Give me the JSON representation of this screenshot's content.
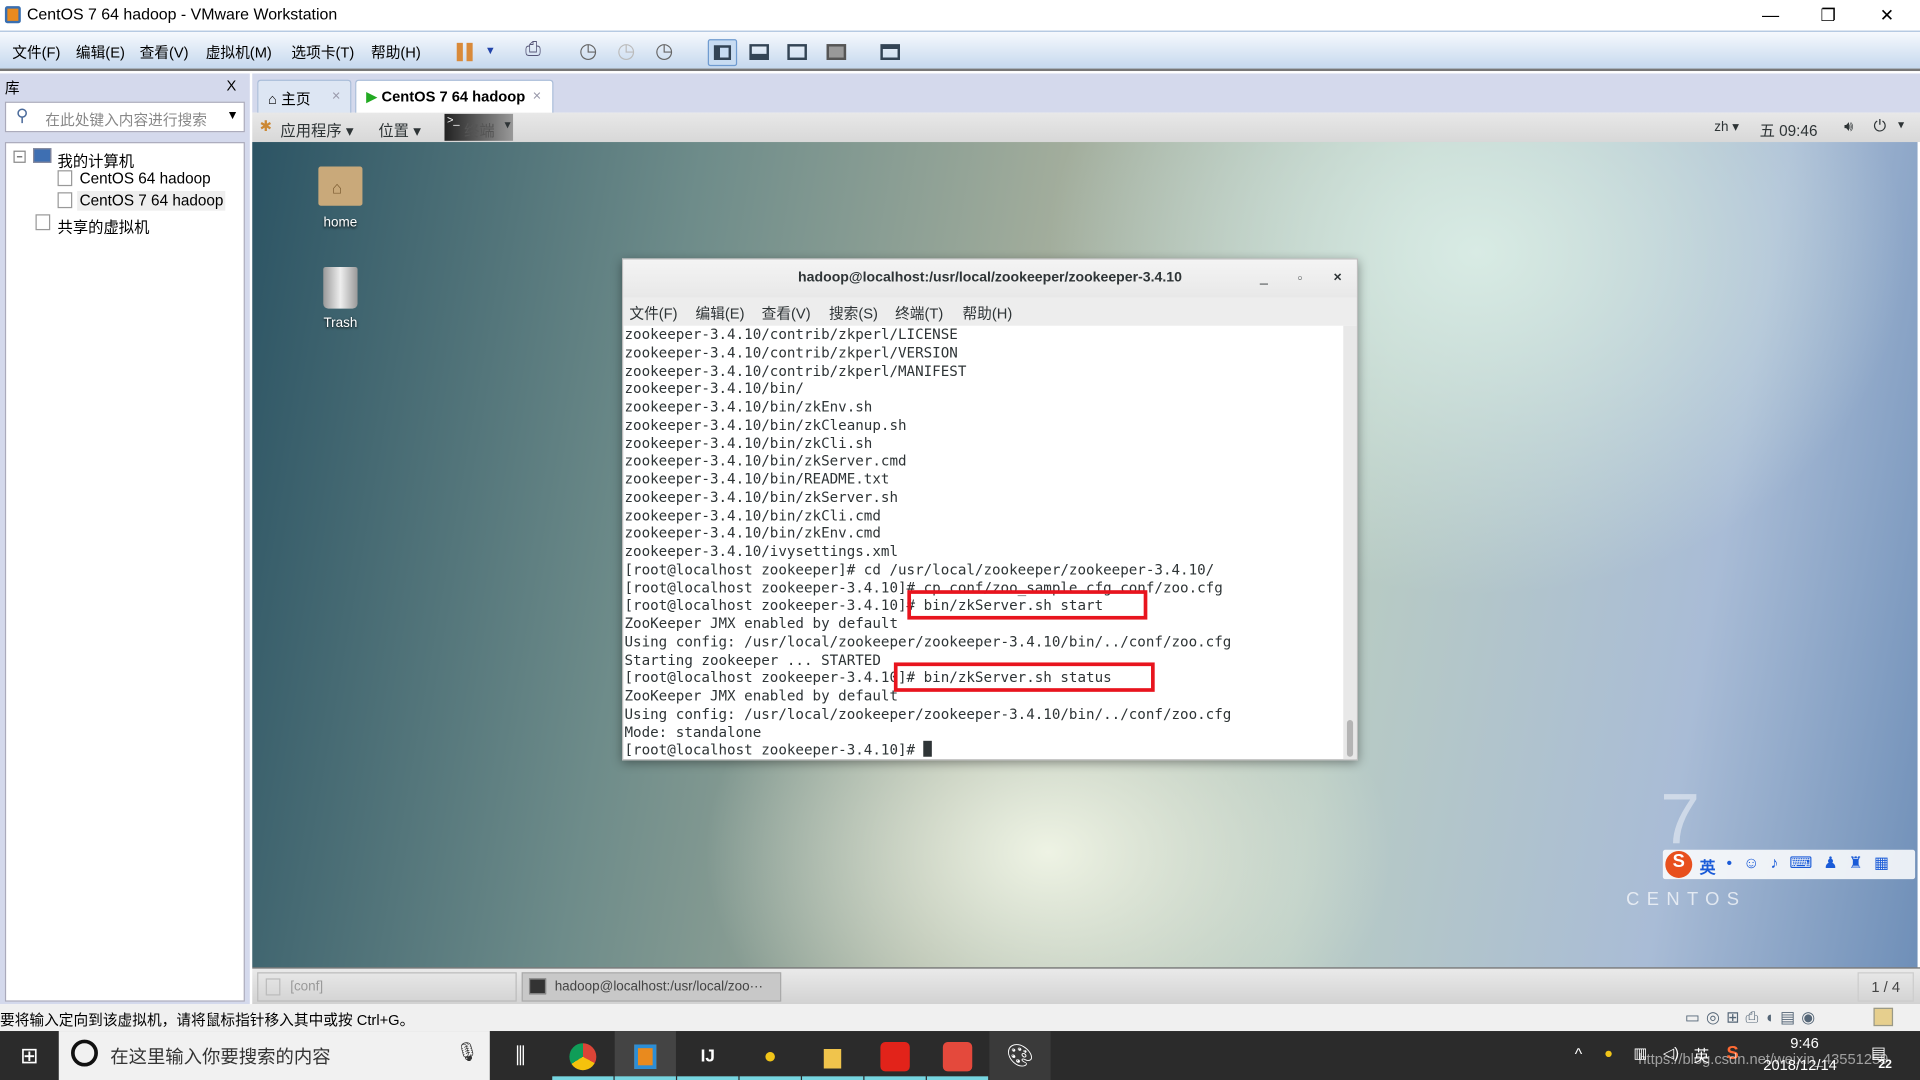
{
  "window": {
    "title": "CentOS 7 64 hadoop - VMware Workstation",
    "minimize": "—",
    "restore": "❐",
    "close": "✕"
  },
  "menu": [
    "文件(F)",
    "编辑(E)",
    "查看(V)",
    "虚拟机(M)",
    "选项卡(T)",
    "帮助(H)"
  ],
  "library": {
    "title": "库",
    "close": "X",
    "search_placeholder": "在此处键入内容进行搜索",
    "tree": {
      "root": "我的计算机",
      "vms": [
        "CentOS 64 hadoop",
        "CentOS 7 64 hadoop"
      ],
      "shared": "共享的虚拟机"
    }
  },
  "tabs": [
    {
      "label": "主页",
      "close": "×"
    },
    {
      "label": "CentOS 7 64 hadoop",
      "close": "×"
    }
  ],
  "gnome": {
    "apps": "应用程序",
    "places": "位置",
    "terminal": "终端",
    "lang": "zh",
    "clock": "五 09:46"
  },
  "desktop": {
    "icons": [
      "home",
      "Trash"
    ],
    "logo_text": "CENTOS",
    "logo_num": "7"
  },
  "terminal": {
    "title": "hadoop@localhost:/usr/local/zookeeper/zookeeper-3.4.10",
    "menu": [
      "文件(F)",
      "编辑(E)",
      "查看(V)",
      "搜索(S)",
      "终端(T)",
      "帮助(H)"
    ],
    "lines": [
      "zookeeper-3.4.10/contrib/zkperl/LICENSE",
      "zookeeper-3.4.10/contrib/zkperl/VERSION",
      "zookeeper-3.4.10/contrib/zkperl/MANIFEST",
      "zookeeper-3.4.10/bin/",
      "zookeeper-3.4.10/bin/zkEnv.sh",
      "zookeeper-3.4.10/bin/zkCleanup.sh",
      "zookeeper-3.4.10/bin/zkCli.sh",
      "zookeeper-3.4.10/bin/zkServer.cmd",
      "zookeeper-3.4.10/bin/README.txt",
      "zookeeper-3.4.10/bin/zkServer.sh",
      "zookeeper-3.4.10/bin/zkCli.cmd",
      "zookeeper-3.4.10/bin/zkEnv.cmd",
      "zookeeper-3.4.10/ivysettings.xml",
      "[root@localhost zookeeper]# cd /usr/local/zookeeper/zookeeper-3.4.10/",
      "[root@localhost zookeeper-3.4.10]# cp conf/zoo_sample.cfg conf/zoo.cfg",
      "[root@localhost zookeeper-3.4.10]# bin/zkServer.sh start",
      "ZooKeeper JMX enabled by default",
      "Using config: /usr/local/zookeeper/zookeeper-3.4.10/bin/../conf/zoo.cfg",
      "Starting zookeeper ... STARTED",
      "[root@localhost zookeeper-3.4.10]# bin/zkServer.sh status",
      "ZooKeeper JMX enabled by default",
      "Using config: /usr/local/zookeeper/zookeeper-3.4.10/bin/../conf/zoo.cfg",
      "Mode: standalone",
      "[root@localhost zookeeper-3.4.10]# "
    ]
  },
  "window_list": {
    "items": [
      "[conf]",
      "hadoop@localhost:/usr/local/zoo···"
    ],
    "workspace": "1 / 4"
  },
  "status_message": "要将输入定向到该虚拟机，请将鼠标指针移入其中或按 Ctrl+G。",
  "taskbar": {
    "search_placeholder": "在这里输入你要搜索的内容",
    "time": "9:46",
    "date": "2018/12/14",
    "ime": "英",
    "notifications": "22",
    "watermark": "https://blog.csdn.net/weixin_43551259"
  },
  "colors": {
    "highlight": "#e8141e",
    "accent": "#76d5e0"
  }
}
